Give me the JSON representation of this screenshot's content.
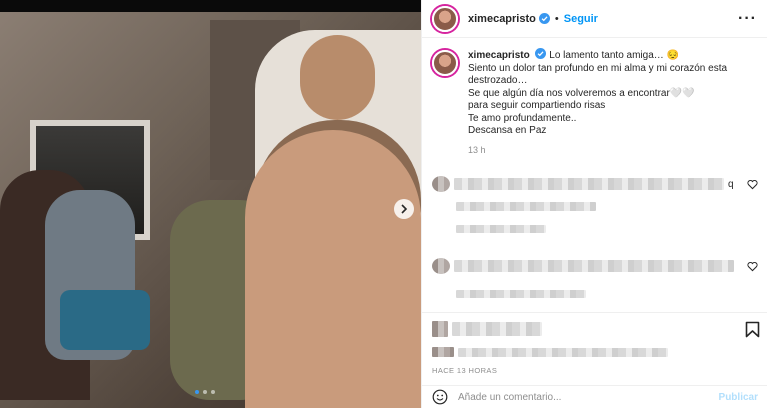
{
  "post": {
    "username": "ximecapristo",
    "follow_label": "Seguir",
    "separator": "•",
    "more_icon": "more-horizontal-icon",
    "caption_lines": [
      "Lo lamento tanto amiga… 😔",
      "Siento un dolor tan profundo en mi alma y mi corazón esta",
      "destrozado…",
      "Se que algún día nos volveremos a encontrar🤍🤍",
      "para seguir compartiendo risas",
      "Te amo profundamente..",
      "Descansa en Paz"
    ],
    "time_ago": "13 h",
    "posted_label": "HACE 13 HORAS",
    "carousel_dots": 3,
    "active_dot": 0
  },
  "comments": [
    {
      "trailing_char": "q"
    },
    {},
    {}
  ],
  "add_comment": {
    "placeholder": "Añade un comentario...",
    "publish_label": "Publicar"
  },
  "colors": {
    "accent": "#0095f6",
    "publish_disabled": "#b2dffc",
    "muted": "#8e8e8e",
    "verified": "#3897f0"
  }
}
